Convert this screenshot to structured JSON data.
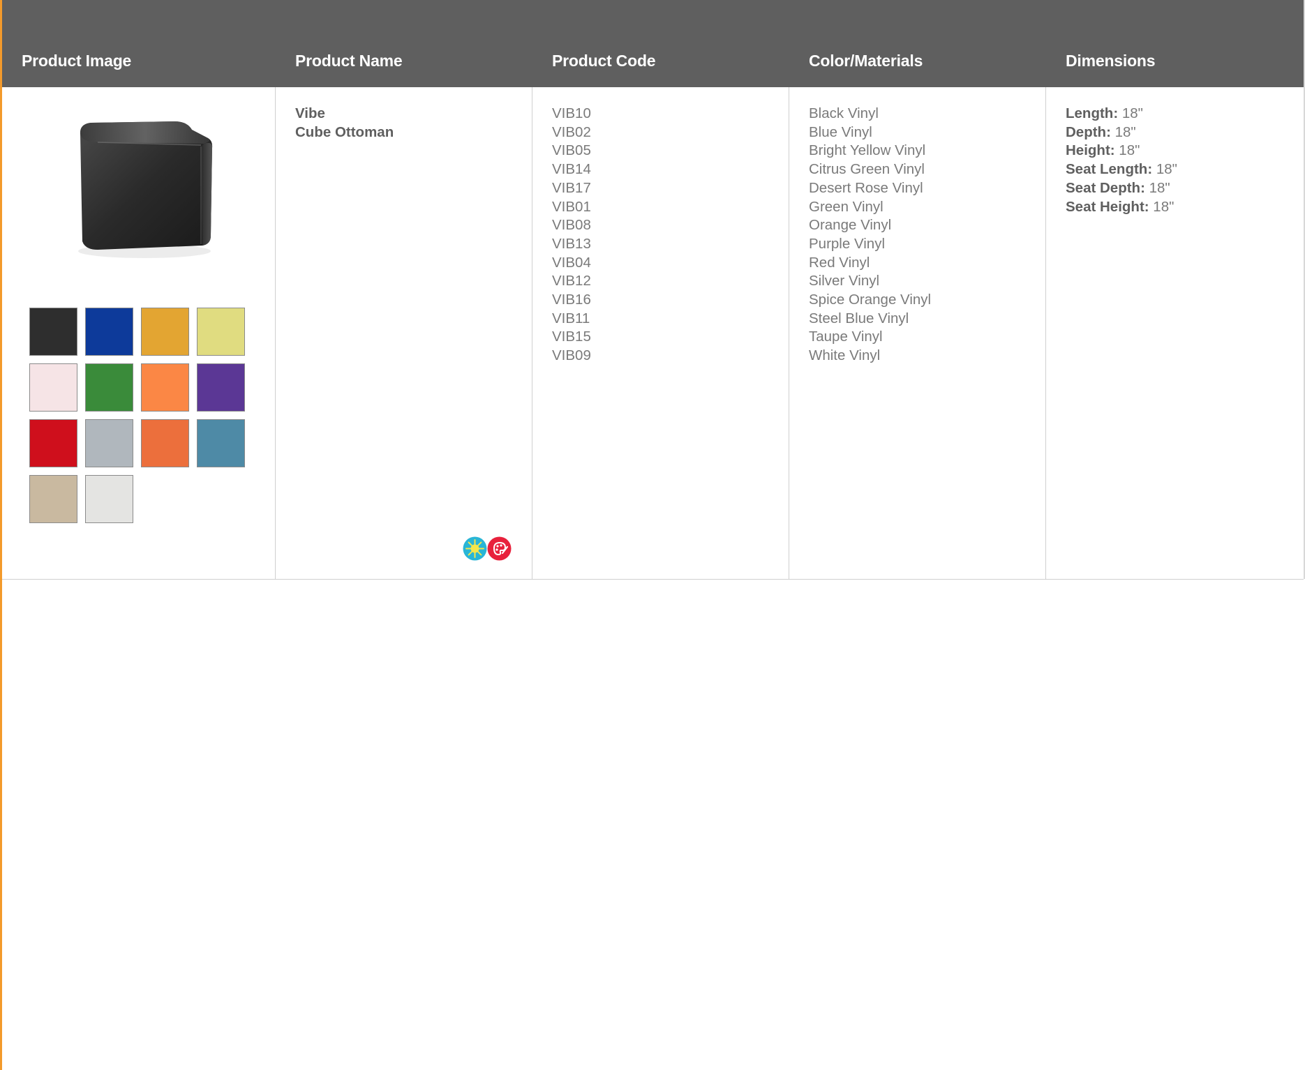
{
  "header": {
    "col1": "Product Image",
    "col2": "Product Name",
    "col3": "Product Code",
    "col4": "Color/Materials",
    "col5": "Dimensions"
  },
  "product": {
    "name_line1": "Vibe",
    "name_line2": "Cube Ottoman",
    "image_icon": "cube-ottoman-image",
    "codes": [
      "VIB10",
      "VIB02",
      "VIB05",
      "VIB14",
      "VIB17",
      "VIB01",
      "VIB08",
      "VIB13",
      "VIB04",
      "VIB12",
      "VIB16",
      "VIB11",
      "VIB15",
      "VIB09"
    ],
    "colors": [
      "Black Vinyl",
      "Blue Vinyl",
      "Bright Yellow Vinyl",
      "Citrus Green Vinyl",
      "Desert Rose Vinyl",
      "Green Vinyl",
      "Orange Vinyl",
      "Purple Vinyl",
      "Red Vinyl",
      "Silver Vinyl",
      "Spice Orange Vinyl",
      "Steel Blue Vinyl",
      "Taupe Vinyl",
      "White Vinyl"
    ],
    "swatch_colors": [
      "#2e2e2e",
      "#0d3a9a",
      "#e3a532",
      "#e0dc80",
      "#f6e4e6",
      "#3a8b3a",
      "#fb8745",
      "#5b3795",
      "#cf0f1c",
      "#b0b7bd",
      "#ec6f3c",
      "#4e8aa6",
      "#c9b9a0",
      "#e4e4e2"
    ],
    "dimensions": [
      {
        "label": "Length:",
        "value": " 18\""
      },
      {
        "label": "Depth:",
        "value": " 18\""
      },
      {
        "label": "Height:",
        "value": " 18\""
      },
      {
        "label": "Seat Length:",
        "value": " 18\""
      },
      {
        "label": "Seat Depth:",
        "value": " 18\""
      },
      {
        "label": "Seat Height:",
        "value": " 18\""
      }
    ],
    "badges": [
      {
        "icon": "sun-icon",
        "color": "#29b5d6"
      },
      {
        "icon": "palette-icon",
        "color": "#e8213c"
      }
    ]
  },
  "colors": {
    "header_bg": "#5f5f5f",
    "accent": "#f39a2b",
    "text": "#7a7a7a"
  }
}
